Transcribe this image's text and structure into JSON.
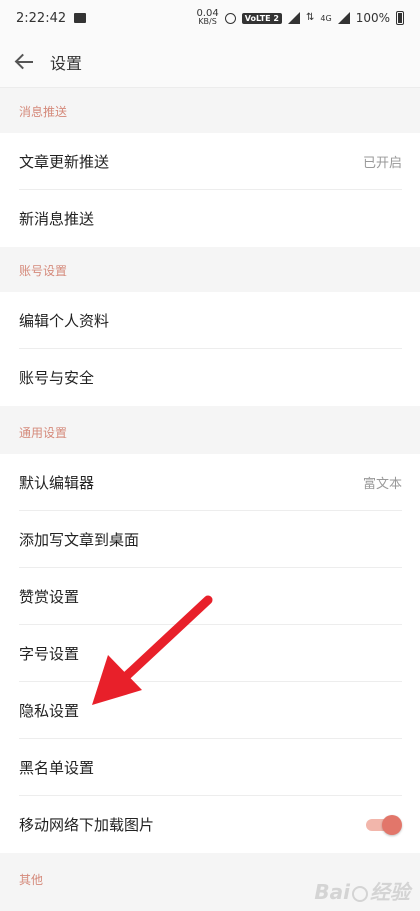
{
  "status_bar": {
    "time": "2:22:42",
    "net_speed_value": "0.04",
    "net_speed_unit": "KB/S",
    "volte": "VoLTE 2",
    "net_type": "4G",
    "battery": "100%"
  },
  "header": {
    "title": "设置"
  },
  "sections": {
    "push": {
      "title": "消息推送",
      "items": [
        {
          "label": "文章更新推送",
          "value": "已开启"
        },
        {
          "label": "新消息推送"
        }
      ]
    },
    "account": {
      "title": "账号设置",
      "items": [
        {
          "label": "编辑个人资料"
        },
        {
          "label": "账号与安全"
        }
      ]
    },
    "general": {
      "title": "通用设置",
      "items": [
        {
          "label": "默认编辑器",
          "value": "富文本"
        },
        {
          "label": "添加写文章到桌面"
        },
        {
          "label": "赞赏设置"
        },
        {
          "label": "字号设置"
        },
        {
          "label": "隐私设置"
        },
        {
          "label": "黑名单设置"
        },
        {
          "label": "移动网络下加载图片",
          "toggle_on": true
        }
      ]
    },
    "other": {
      "title": "其他"
    }
  },
  "watermark": {
    "text_left": "Bai",
    "text_right": "经验"
  },
  "colors": {
    "section_title": "#d58a7b",
    "toggle_thumb": "#e2766a",
    "toggle_track": "#f2b6ab",
    "arrow": "#e8202a"
  }
}
